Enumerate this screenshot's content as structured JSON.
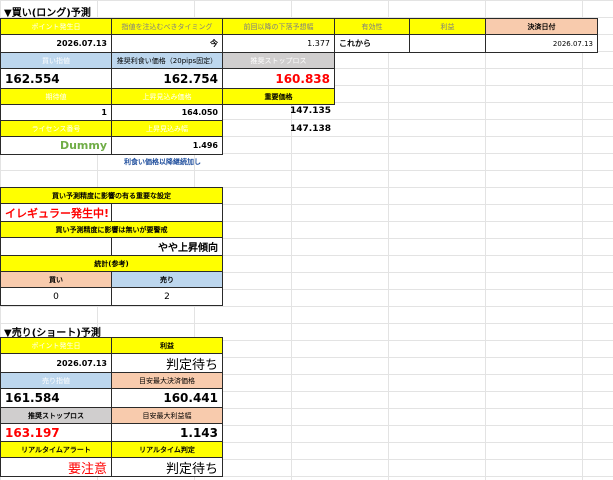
{
  "long": {
    "title": "▼買い(ロング)予測",
    "headers": {
      "point_date": "ポイント発生日",
      "entry_timing": "指値を注込むべきタイミング",
      "expected_range": "前回以降の下落予想幅",
      "validity": "有効性",
      "profit": "利益",
      "settle_date": "決済日付"
    },
    "values": {
      "point_date": "2026.07.13",
      "entry_timing": "今",
      "expected_range": "1.377",
      "validity": "これから",
      "profit": "",
      "settle_date": "2026.07.13"
    },
    "row2_headers": {
      "buy_limit": "買い指値",
      "buy_price_20pips": "推奨利食い価格（20pips固定）",
      "stoploss": "推奨ストップロス"
    },
    "row2_values": {
      "buy_limit": "162.554",
      "buy_price_20pips": "162.754",
      "stoploss": "160.838"
    },
    "row3_headers": {
      "expected": "期待値",
      "upper_expected": "上昇見込み価格",
      "important_price": "重要価格"
    },
    "row3_values": {
      "expected": "1",
      "upper_expected": "164.050",
      "important_price_1": "147.135",
      "important_price_2": "147.138"
    },
    "row4_headers": {
      "license": "ライセンス番号",
      "upper_range": "上昇見込み幅"
    },
    "row4_values": {
      "license": "Dummy",
      "upper_range": "1.496"
    },
    "link_text": "利食い価格以降継続加し"
  },
  "settings": {
    "header1": "買い予測精度に影響の有る重要な設定",
    "irregular": "イレギュラー発生中!",
    "header2": "買い予測精度に影響は無いが要警戒",
    "trend": "やや上昇傾向",
    "count_header": "統計(参考)",
    "buy_label": "買い",
    "sell_label": "売り",
    "buy_count": "0",
    "sell_count": "2"
  },
  "short": {
    "title": "▼売り(ショート)予測",
    "point_date_label": "ポイント発生日",
    "profit_label": "利益",
    "point_date": "2026.07.13",
    "profit_value": "判定待ち",
    "sell_limit_label": "売り指値",
    "target_label": "目安最大決済価格",
    "sell_limit": "161.584",
    "target": "160.441",
    "stoploss_label": "推奨ストップロス",
    "max_profit_label": "目安最大利益幅",
    "stoploss": "163.197",
    "max_profit": "1.143",
    "alert_label": "リアルタイムアラート",
    "judge_label": "リアルタイム判定",
    "alert_value": "要注意",
    "judge_value": "判定待ち"
  },
  "colors": {
    "yellow": "#ffff00",
    "blue": "#bdd7ee",
    "gray": "#d0cece",
    "peach": "#f8cbad",
    "red": "#ff0000",
    "green": "#70ad47"
  }
}
